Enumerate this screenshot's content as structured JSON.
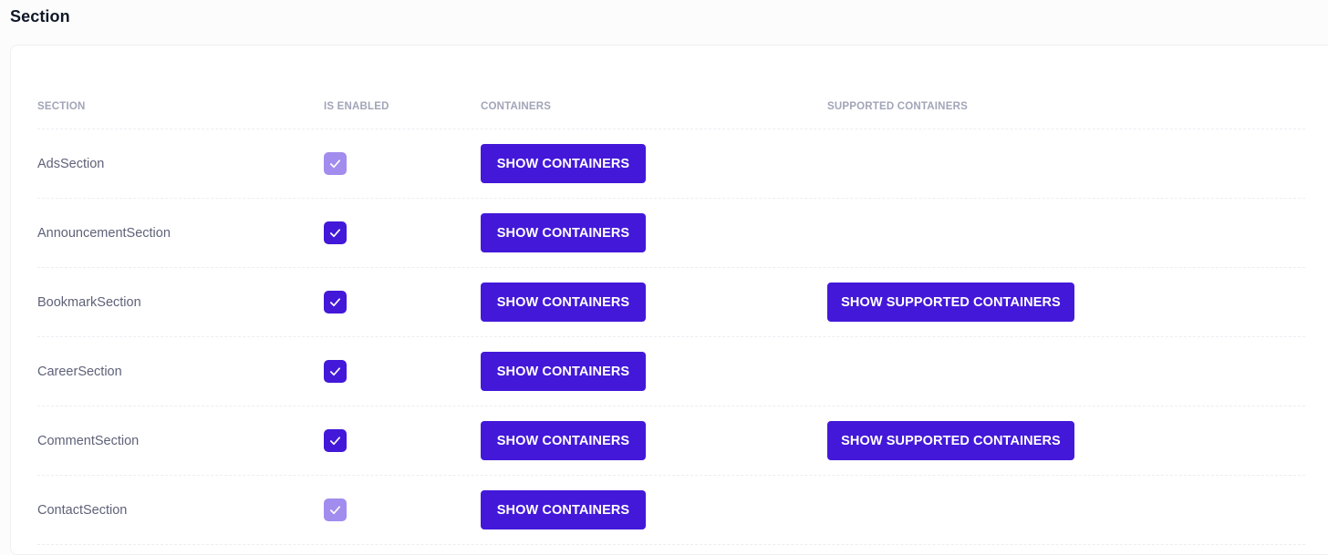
{
  "page": {
    "title": "Section"
  },
  "table": {
    "columns": [
      "SECTION",
      "IS ENABLED",
      "CONTAINERS",
      "SUPPORTED CONTAINERS"
    ],
    "rows": [
      {
        "name": "AdsSection",
        "enabled": true,
        "checkbox_disabled": true,
        "containers_label": "SHOW CONTAINERS",
        "supported_label": null
      },
      {
        "name": "AnnouncementSection",
        "enabled": true,
        "checkbox_disabled": false,
        "containers_label": "SHOW CONTAINERS",
        "supported_label": null
      },
      {
        "name": "BookmarkSection",
        "enabled": true,
        "checkbox_disabled": false,
        "containers_label": "SHOW CONTAINERS",
        "supported_label": "SHOW SUPPORTED CONTAINERS"
      },
      {
        "name": "CareerSection",
        "enabled": true,
        "checkbox_disabled": false,
        "containers_label": "SHOW CONTAINERS",
        "supported_label": null
      },
      {
        "name": "CommentSection",
        "enabled": true,
        "checkbox_disabled": false,
        "containers_label": "SHOW CONTAINERS",
        "supported_label": "SHOW SUPPORTED CONTAINERS"
      },
      {
        "name": "ContactSection",
        "enabled": true,
        "checkbox_disabled": true,
        "containers_label": "SHOW CONTAINERS",
        "supported_label": null
      }
    ]
  },
  "icons": {
    "checkbox": "check-icon"
  },
  "colors": {
    "primary": "#4318d9",
    "primary_disabled": "#a28cee",
    "header_text": "#a1a5b7",
    "cell_text": "#5e6278",
    "title_text": "#111827"
  }
}
